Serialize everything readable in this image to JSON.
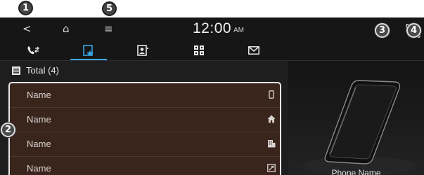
{
  "callouts": [
    "1",
    "5",
    "3",
    "4",
    "2"
  ],
  "status_bar": {
    "back_glyph": "<",
    "home_glyph": "⌂",
    "menu_glyph": "≡",
    "time": "12:00",
    "ampm": "AM"
  },
  "tabs": [
    {
      "icon": "call-history-icon",
      "active": false
    },
    {
      "icon": "favorites-icon",
      "active": true
    },
    {
      "icon": "contacts-icon",
      "active": false
    },
    {
      "icon": "keypad-icon",
      "active": false
    },
    {
      "icon": "messages-icon",
      "active": false
    }
  ],
  "list_header": {
    "label": "Total (4)"
  },
  "list": {
    "items": [
      {
        "name": "Name",
        "type_icon": "mobile-icon"
      },
      {
        "name": "Name",
        "type_icon": "home-phone-icon"
      },
      {
        "name": "Name",
        "type_icon": "office-phone-icon"
      },
      {
        "name": "Name",
        "type_icon": "other-phone-icon"
      }
    ]
  },
  "device_panel": {
    "phone_name": "Phone Name"
  },
  "colors": {
    "accent": "#3aa7e6",
    "list_background": "#3a251d",
    "screen_background": "#1e1e1e"
  }
}
